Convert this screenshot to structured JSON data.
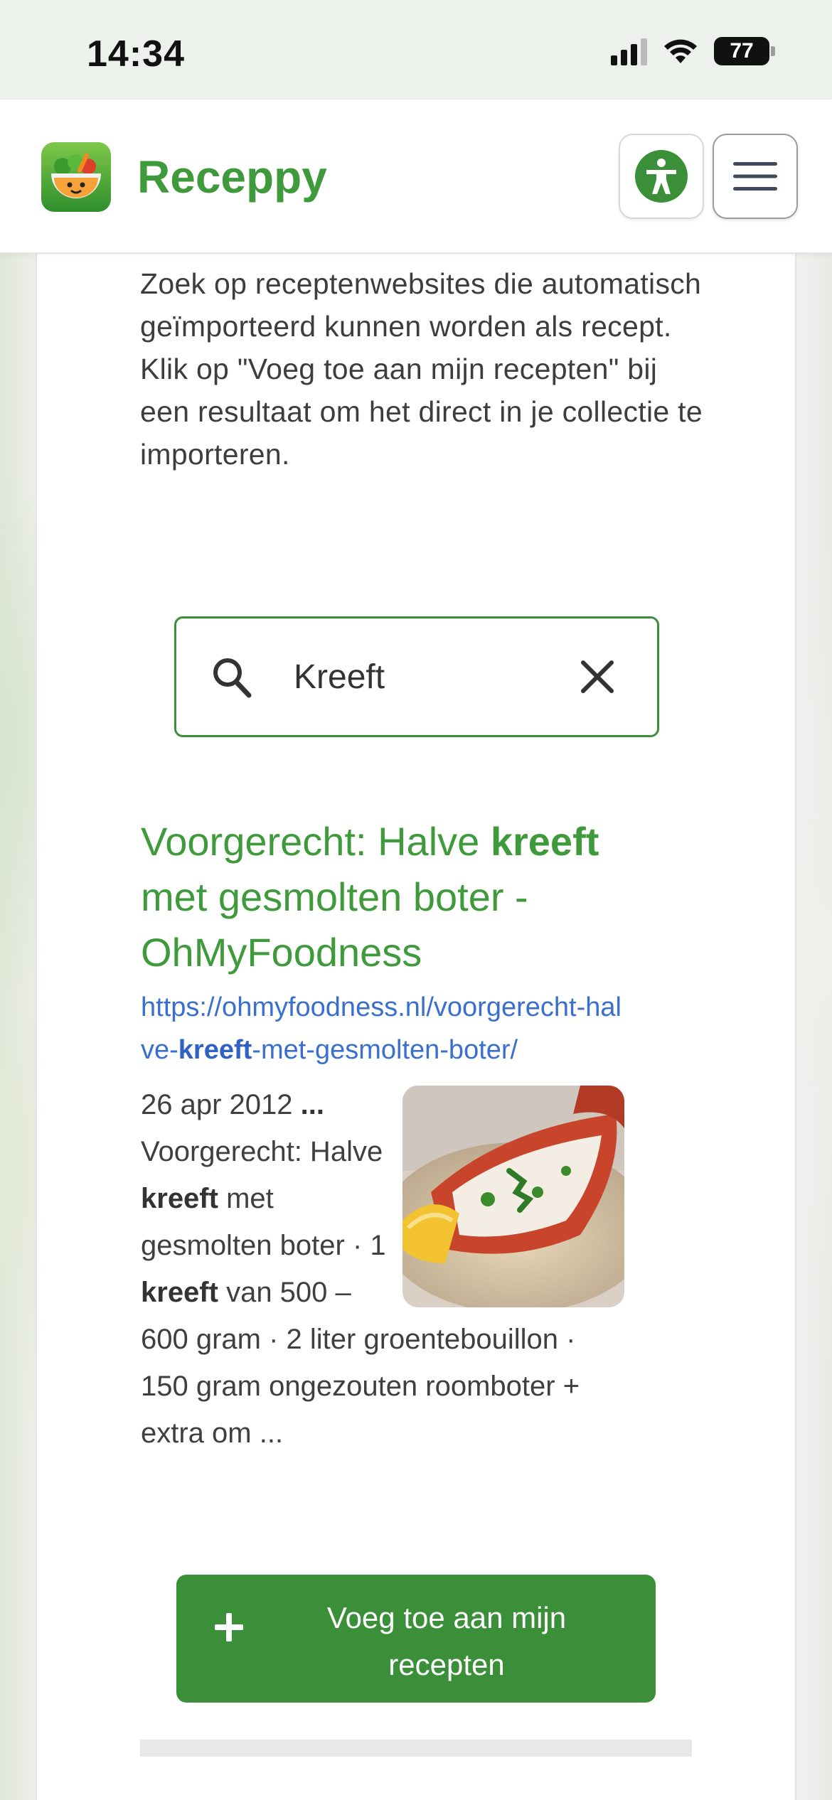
{
  "status_bar": {
    "time": "14:34",
    "battery": "77",
    "icons": [
      "signal-icon",
      "wifi-icon",
      "battery-icon"
    ]
  },
  "header": {
    "brand": "Receppy",
    "logo_icon": "salad-bowl-logo-icon",
    "a11y_icon": "accessibility-icon",
    "menu_icon": "hamburger-menu-icon"
  },
  "intro": {
    "text": "Zoek op receptenwebsites die automatisch geïmporteerd kunnen worden als recept. Klik op \"Voeg toe aan mijn recepten\" bij een resultaat om het direct in je collectie te importeren."
  },
  "search": {
    "value": "Kreeft",
    "placeholder": ""
  },
  "result": {
    "title_pre": "Voorgerecht: Halve ",
    "title_bold": "kreeft",
    "title_post": " met gesmolten boter - OhMyFoodness",
    "url_pre": "https://ohmyfoodness.nl/voorgerecht-halve-",
    "url_bold": "kreeft",
    "url_post": "-met-gesmolten-boter/",
    "snippet_date": "26 apr 2012",
    "snippet_ellipsis": " ...",
    "snippet_part1": " Voorgerecht: Halve ",
    "snippet_bold1": "kreeft",
    "snippet_part2": " met gesmolten boter · 1 ",
    "snippet_bold2": "kreeft",
    "snippet_part3": " van 500 – 600 gram · 2 liter groentebouillon · 150 gram ongezouten roomboter + extra om ...",
    "image_icon": "lobster-dish-image"
  },
  "add_button": {
    "label": "Voeg toe aan mijn recepten",
    "icon": "plus-icon"
  },
  "colors": {
    "brand_green": "#3e9a3a",
    "button_green": "#3a8f38",
    "link_blue": "#3a6fd0"
  }
}
